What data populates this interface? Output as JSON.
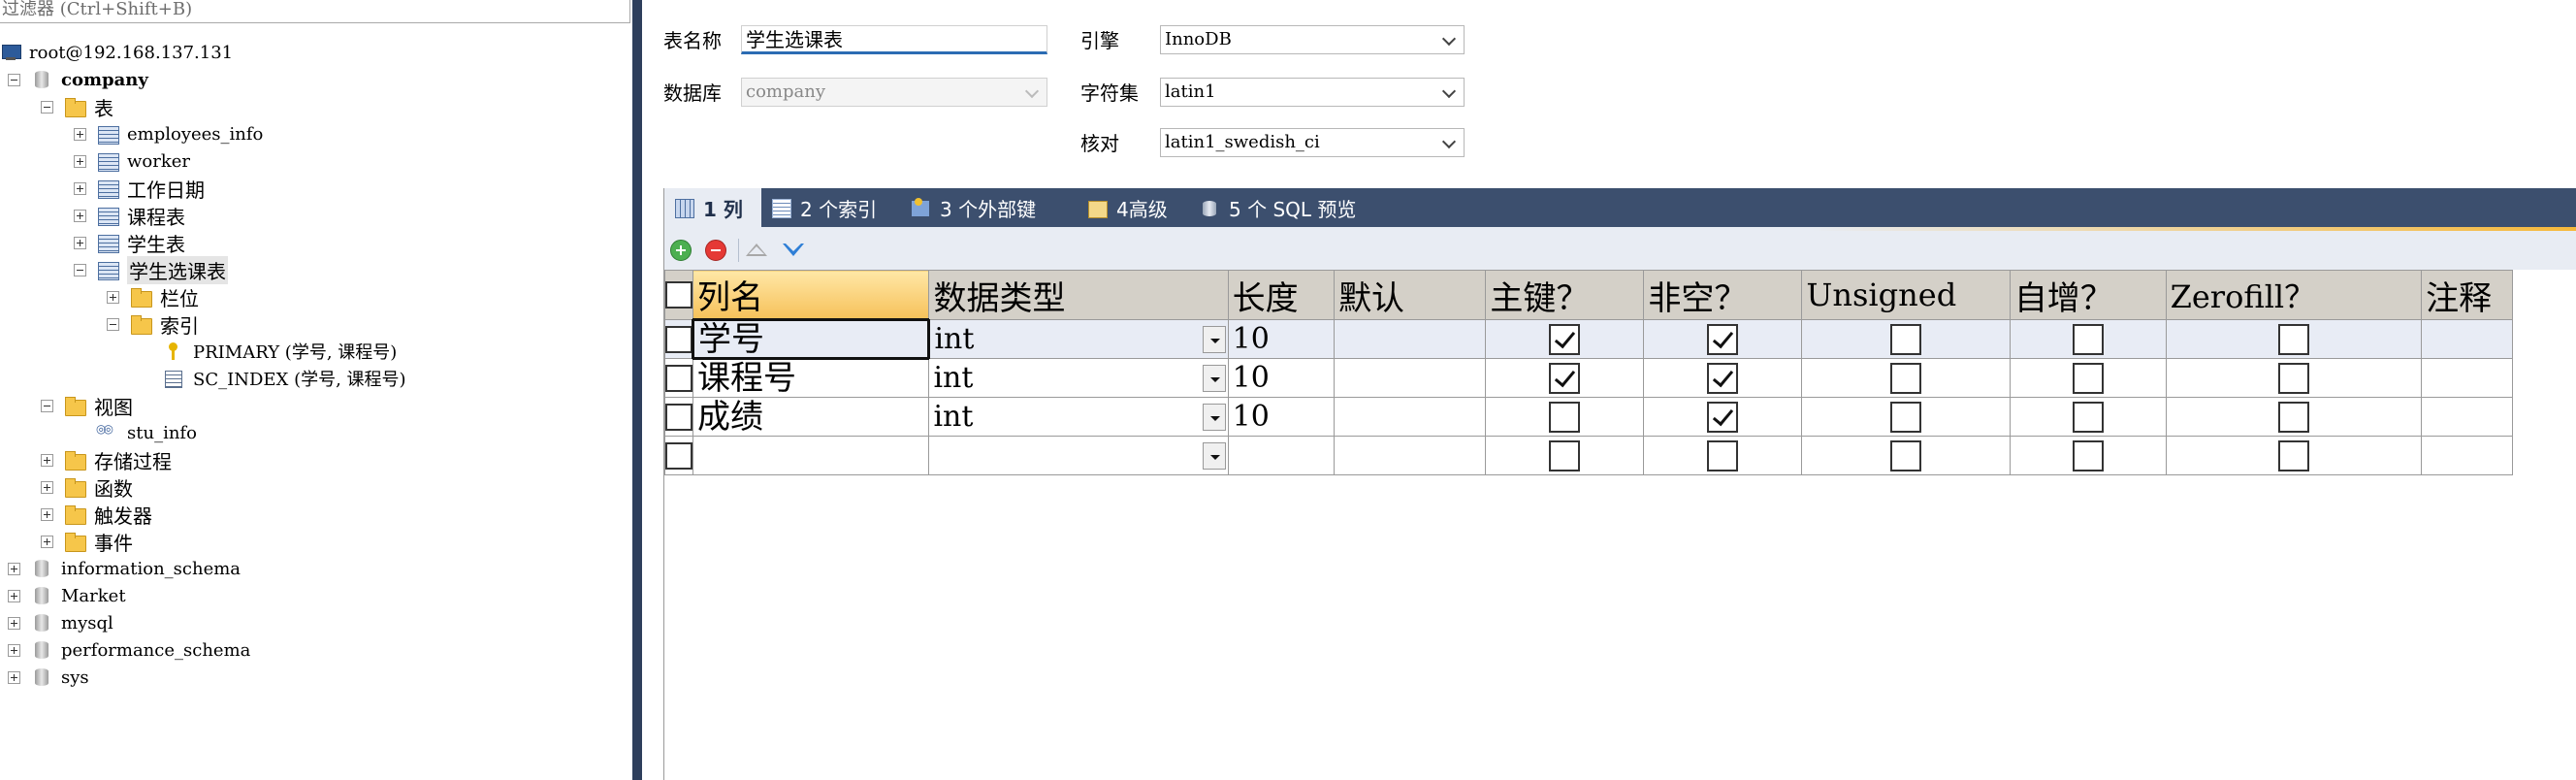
{
  "filter": {
    "placeholder": "过滤器 (Ctrl+Shift+B)"
  },
  "tree": {
    "server": "root@192.168.137.131",
    "database": "company",
    "tables_folder": "表",
    "tables": [
      "employees_info",
      "worker",
      "工作日期",
      "课程表",
      "学生表",
      "学生选课表"
    ],
    "columns_folder": "栏位",
    "indexes_folder": "索引",
    "indexes": [
      "PRIMARY (学号, 课程号)",
      "SC_INDEX (学号, 课程号)"
    ],
    "views_folder": "视图",
    "views": [
      "stu_info"
    ],
    "procedures_folder": "存储过程",
    "functions_folder": "函数",
    "triggers_folder": "触发器",
    "events_folder": "事件",
    "other_databases": [
      "information_schema",
      "Market",
      "mysql",
      "performance_schema",
      "sys"
    ]
  },
  "form": {
    "table_name_label": "表名称",
    "table_name": "学生选课表",
    "database_label": "数据库",
    "database": "company",
    "engine_label": "引擎",
    "engine": "InnoDB",
    "charset_label": "字符集",
    "charset": "latin1",
    "collation_label": "核对",
    "collation": "latin1_swedish_ci"
  },
  "tabs": [
    {
      "label": "1 列",
      "icon": "columns-icon"
    },
    {
      "label": "2 个索引",
      "icon": "index-icon"
    },
    {
      "label": "3 个外部键",
      "icon": "foreign-key-icon"
    },
    {
      "label": "4高级",
      "icon": "advanced-icon"
    },
    {
      "label": "5 个 SQL 预览",
      "icon": "sql-preview-icon"
    }
  ],
  "grid": {
    "headers": [
      "列名",
      "数据类型",
      "长度",
      "默认",
      "主键？",
      "非空？",
      "Unsigned",
      "自增？",
      "Zerofill？",
      "注释"
    ],
    "rows": [
      {
        "name": "学号",
        "type": "int",
        "length": "10",
        "default": "",
        "pk": true,
        "notnull": true,
        "unsigned": false,
        "autoinc": false,
        "zerofill": false,
        "comment": ""
      },
      {
        "name": "课程号",
        "type": "int",
        "length": "10",
        "default": "",
        "pk": true,
        "notnull": true,
        "unsigned": false,
        "autoinc": false,
        "zerofill": false,
        "comment": ""
      },
      {
        "name": "成绩",
        "type": "int",
        "length": "10",
        "default": "",
        "pk": false,
        "notnull": true,
        "unsigned": false,
        "autoinc": false,
        "zerofill": false,
        "comment": ""
      },
      {
        "name": "",
        "type": "",
        "length": "",
        "default": "",
        "pk": false,
        "notnull": false,
        "unsigned": false,
        "autoinc": false,
        "zerofill": false,
        "comment": ""
      }
    ]
  },
  "colors": {
    "tab_bar": "#3c4f6e",
    "splitter": "#2e3f5c",
    "header_bg": "#d4d0c8",
    "name_header": "#f6c15a"
  }
}
